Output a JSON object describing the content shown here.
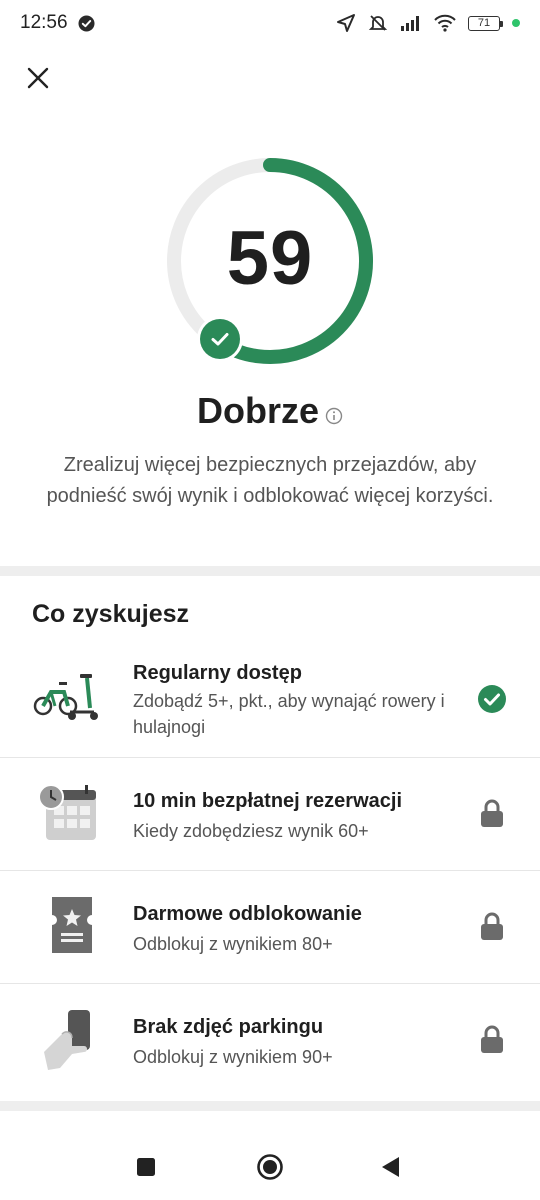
{
  "status_bar": {
    "time": "12:56",
    "battery": "71",
    "icons": [
      "check-circle-icon",
      "location-arrow-icon",
      "bell-muted-icon",
      "signal-icon",
      "wifi-icon",
      "battery-icon",
      "green-dot-icon"
    ]
  },
  "header": {
    "close_icon": "close-icon"
  },
  "score": {
    "value": "59",
    "progress_fraction": 0.59,
    "rating_label": "Dobrze",
    "description": "Zrealizuj więcej bezpiecznych przejazdów, aby podnieść swój wynik i odblokować więcej korzyści.",
    "colors": {
      "arc": "#2b8a58",
      "track": "#ececec"
    }
  },
  "benefits_section": {
    "title": "Co zyskujesz",
    "items": [
      {
        "title": "Regularny dostęp",
        "description": "Zdobądź 5+, pkt., aby wynająć rowery i hulajnogi",
        "illustration": "bike-scooter-icon",
        "status": "unlocked",
        "status_icon": "check-circle-icon"
      },
      {
        "title": "10 min bezpłatnej rezerwacji",
        "description": "Kiedy zdobędziesz wynik 60+",
        "illustration": "calendar-clock-icon",
        "status": "locked",
        "status_icon": "lock-icon"
      },
      {
        "title": "Darmowe odblokowanie",
        "description": "Odblokuj z wynikiem 80+",
        "illustration": "ticket-star-icon",
        "status": "locked",
        "status_icon": "lock-icon"
      },
      {
        "title": "Brak zdjęć parkingu",
        "description": "Odblokuj z wynikiem 90+",
        "illustration": "hand-phone-icon",
        "status": "locked",
        "status_icon": "lock-icon"
      }
    ]
  },
  "nav_bar": {
    "buttons": [
      "recents-square-icon",
      "home-circle-icon",
      "back-triangle-icon"
    ]
  }
}
